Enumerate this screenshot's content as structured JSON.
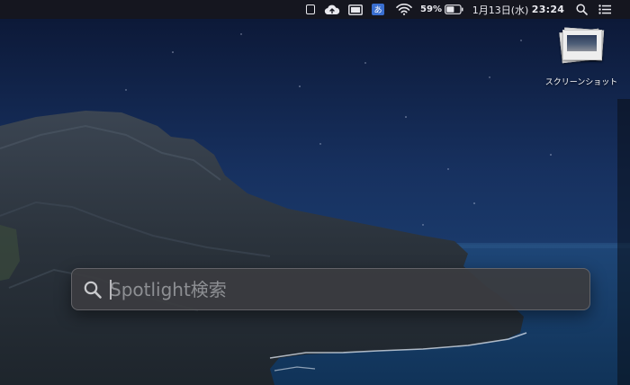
{
  "menubar": {
    "items": [
      {
        "name": "square-status-icon",
        "kind": "icon"
      },
      {
        "name": "cloud-upload-icon",
        "kind": "icon"
      },
      {
        "name": "display-mirror-icon",
        "kind": "icon"
      },
      {
        "name": "input-method-icon",
        "kind": "text",
        "label": "あ"
      },
      {
        "name": "wifi-icon",
        "kind": "icon"
      },
      {
        "name": "battery-percent",
        "kind": "text",
        "label": "59%"
      },
      {
        "name": "battery-icon",
        "kind": "icon",
        "level": 0.59
      }
    ],
    "date": "1月13日(水)",
    "time": "23:24",
    "search_icon": "search-icon",
    "control_icon": "list-menu-icon"
  },
  "desktop": {
    "icons": [
      {
        "label": "スクリーンショット",
        "icon": "screenshot-stack-icon"
      }
    ]
  },
  "spotlight": {
    "placeholder": "Spotlight検索",
    "value": "",
    "icon": "search-icon"
  },
  "colors": {
    "menubar_bg": "#15161f",
    "sky_top": "#0c1836",
    "sea": "#1f4a80",
    "spotlight_bg": "#3a3c40",
    "input_method_badge": "#3a6fd0"
  }
}
